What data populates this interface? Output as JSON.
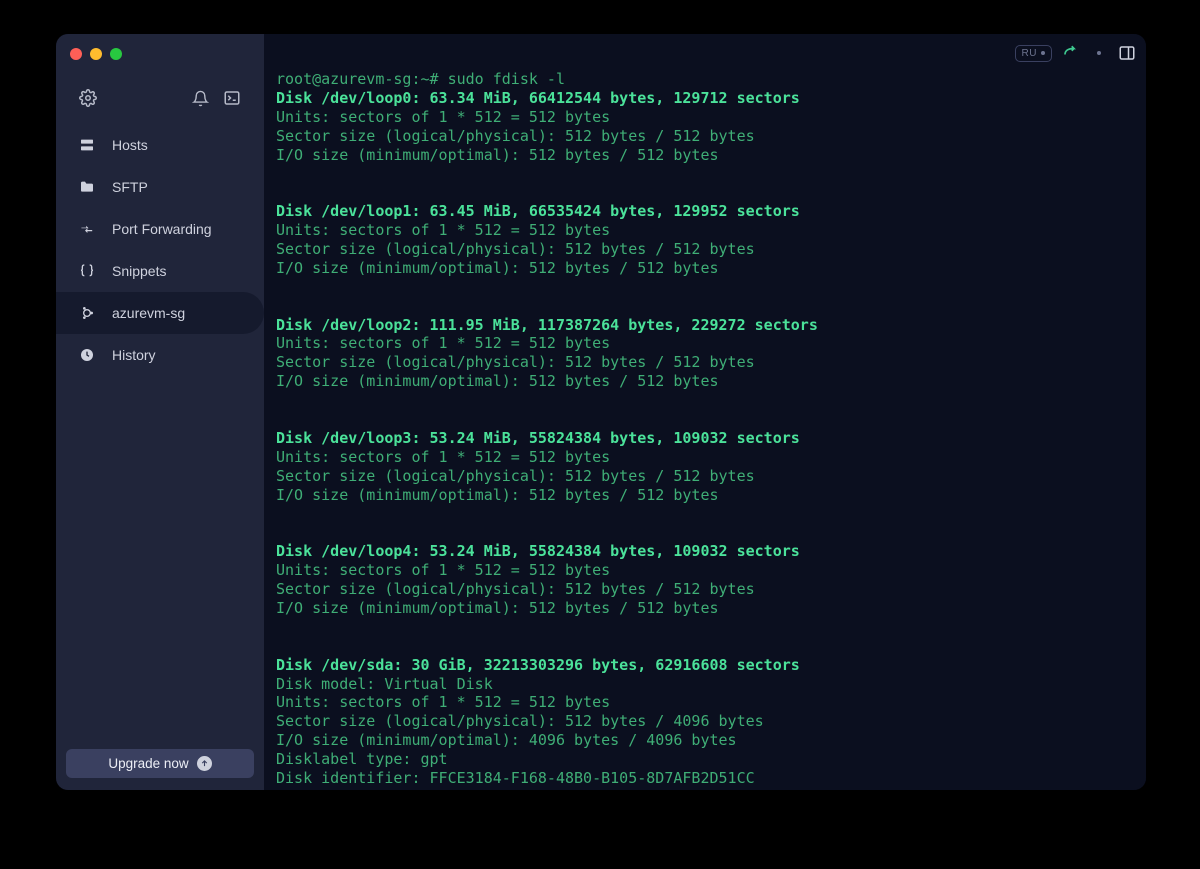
{
  "sidebar": {
    "items": [
      {
        "label": "Hosts"
      },
      {
        "label": "SFTP"
      },
      {
        "label": "Port Forwarding"
      },
      {
        "label": "Snippets"
      },
      {
        "label": "azurevm-sg"
      },
      {
        "label": "History"
      }
    ],
    "upgrade_label": "Upgrade now"
  },
  "topbar": {
    "pill_text": "RU"
  },
  "terminal": {
    "prompt": "root@azurevm-sg:~# sudo fdisk -l",
    "disks": [
      {
        "header": "Disk /dev/loop0: 63.34 MiB, 66412544 bytes, 129712 sectors",
        "lines": [
          "Units: sectors of 1 * 512 = 512 bytes",
          "Sector size (logical/physical): 512 bytes / 512 bytes",
          "I/O size (minimum/optimal): 512 bytes / 512 bytes"
        ]
      },
      {
        "header": "Disk /dev/loop1: 63.45 MiB, 66535424 bytes, 129952 sectors",
        "lines": [
          "Units: sectors of 1 * 512 = 512 bytes",
          "Sector size (logical/physical): 512 bytes / 512 bytes",
          "I/O size (minimum/optimal): 512 bytes / 512 bytes"
        ]
      },
      {
        "header": "Disk /dev/loop2: 111.95 MiB, 117387264 bytes, 229272 sectors",
        "lines": [
          "Units: sectors of 1 * 512 = 512 bytes",
          "Sector size (logical/physical): 512 bytes / 512 bytes",
          "I/O size (minimum/optimal): 512 bytes / 512 bytes"
        ]
      },
      {
        "header": "Disk /dev/loop3: 53.24 MiB, 55824384 bytes, 109032 sectors",
        "lines": [
          "Units: sectors of 1 * 512 = 512 bytes",
          "Sector size (logical/physical): 512 bytes / 512 bytes",
          "I/O size (minimum/optimal): 512 bytes / 512 bytes"
        ]
      },
      {
        "header": "Disk /dev/loop4: 53.24 MiB, 55824384 bytes, 109032 sectors",
        "lines": [
          "Units: sectors of 1 * 512 = 512 bytes",
          "Sector size (logical/physical): 512 bytes / 512 bytes",
          "I/O size (minimum/optimal): 512 bytes / 512 bytes"
        ]
      },
      {
        "header": "Disk /dev/sda: 30 GiB, 32213303296 bytes, 62916608 sectors",
        "lines": [
          "Disk model: Virtual Disk",
          "Units: sectors of 1 * 512 = 512 bytes",
          "Sector size (logical/physical): 512 bytes / 4096 bytes",
          "I/O size (minimum/optimal): 4096 bytes / 4096 bytes",
          "Disklabel type: gpt",
          "Disk identifier: FFCE3184-F168-48B0-B105-8D7AFB2D51CC"
        ]
      }
    ]
  }
}
